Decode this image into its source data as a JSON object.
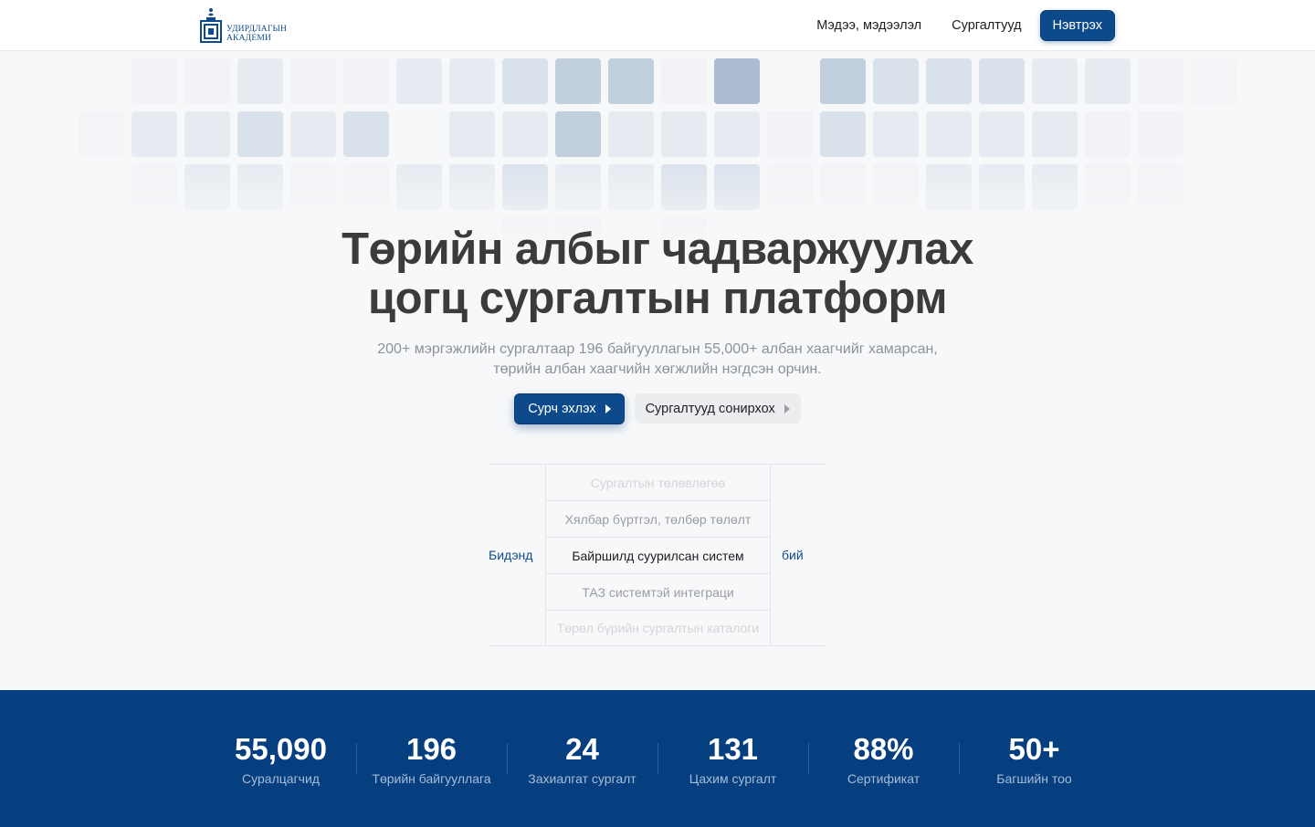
{
  "brand": {
    "logo_line1": "УДИРДЛАГЫН",
    "logo_line2": "АКАДЕМИ",
    "color": "#0d4a8c"
  },
  "nav": {
    "items": [
      "Мэдээ, мэдээлэл",
      "Сургалтууд"
    ],
    "login_label": "Нэвтрэх"
  },
  "hero": {
    "title_line1": "Төрийн албыг чадваржуулах",
    "title_line2": "цогц сургалтын платформ",
    "subtitle_line1": "200+ мэргэжлийн сургалтаар 196 байгууллагын 55,000+ албан хаагчийг хамарсан,",
    "subtitle_line2": "төрийн албан хаагчийн хөгжлийн нэгдсэн орчин.",
    "primary_cta": "Сурч эхлэх",
    "secondary_cta": "Сургалтууд сонирхох"
  },
  "rotator": {
    "prefix": "Бидэнд",
    "suffix": "бий",
    "items": [
      "Сургалтын төлөвлөгөө",
      "Хялбар бүртгэл, төлбөр төлөлт",
      "Байршилд суурилсан систем",
      "ТАЗ системтэй интеграци",
      "Төрөл бүрийн сургалтын каталоги"
    ],
    "active_index": 2
  },
  "stats": [
    {
      "value": "55,090",
      "label": "Суралцагчид"
    },
    {
      "value": "196",
      "label": "Төрийн байгууллага"
    },
    {
      "value": "24",
      "label": "Захиалгат сургалт"
    },
    {
      "value": "131",
      "label": "Цахим сургалт"
    },
    {
      "value": "88%",
      "label": "Сертификат"
    },
    {
      "value": "50+",
      "label": "Багшийн тоо"
    }
  ],
  "colors": {
    "primary": "#0d4a8c",
    "stats_bg": "#063f80",
    "page_bg": "#f7f8f9"
  }
}
